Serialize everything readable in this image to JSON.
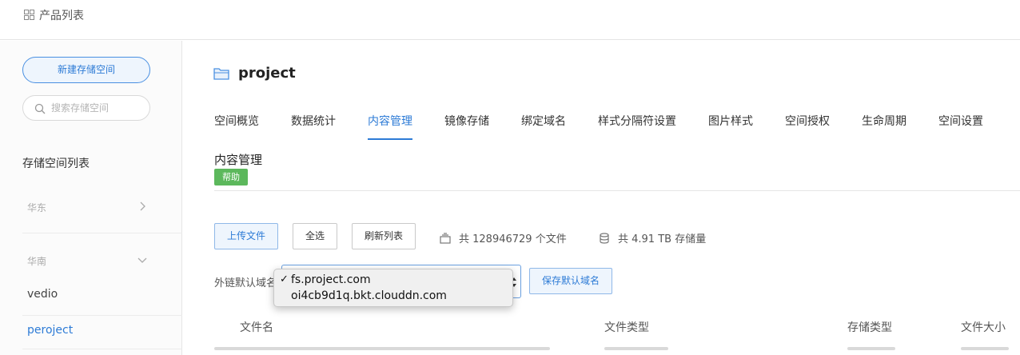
{
  "topbar": {
    "title": "产品列表",
    "icon": "grid-icon"
  },
  "sidebar": {
    "new_bucket_label": "新建存储空间",
    "search_placeholder": "搜索存储空间",
    "list_heading": "存储空间列表",
    "regions": [
      {
        "name": "华东",
        "state": "collapsed",
        "icon": "chevron-right-icon"
      },
      {
        "name": "华南",
        "state": "expanded",
        "icon": "chevron-down-icon"
      }
    ],
    "buckets": [
      {
        "name": "vedio",
        "selected": false
      },
      {
        "name": "peroject",
        "selected": true
      }
    ]
  },
  "main": {
    "bucket_title": "project",
    "bucket_icon": "folder-icon",
    "tabs": [
      {
        "label": "空间概览",
        "active": false
      },
      {
        "label": "数据统计",
        "active": false
      },
      {
        "label": "内容管理",
        "active": true
      },
      {
        "label": "镜像存储",
        "active": false
      },
      {
        "label": "绑定域名",
        "active": false
      },
      {
        "label": "样式分隔符设置",
        "active": false
      },
      {
        "label": "图片样式",
        "active": false
      },
      {
        "label": "空间授权",
        "active": false
      },
      {
        "label": "生命周期",
        "active": false
      },
      {
        "label": "空间设置",
        "active": false
      }
    ],
    "section_title": "内容管理",
    "help_label": "帮助",
    "actions": {
      "upload": "上传文件",
      "select_all": "全选",
      "refresh": "刷新列表"
    },
    "stats": {
      "file_count": "共 128946729 个文件",
      "storage": "共 4.91 TB 存储量"
    },
    "default_domain": {
      "label": "外链默认域名",
      "selected": "fs.project.com",
      "options": [
        "fs.project.com",
        "oi4cb9d1q.bkt.clouddn.com"
      ],
      "save_label": "保存默认域名"
    },
    "table": {
      "columns": [
        "文件名",
        "文件类型",
        "存储类型",
        "文件大小"
      ]
    }
  },
  "colors": {
    "accent": "#2d7bd6",
    "help_green": "#5cb85c"
  }
}
